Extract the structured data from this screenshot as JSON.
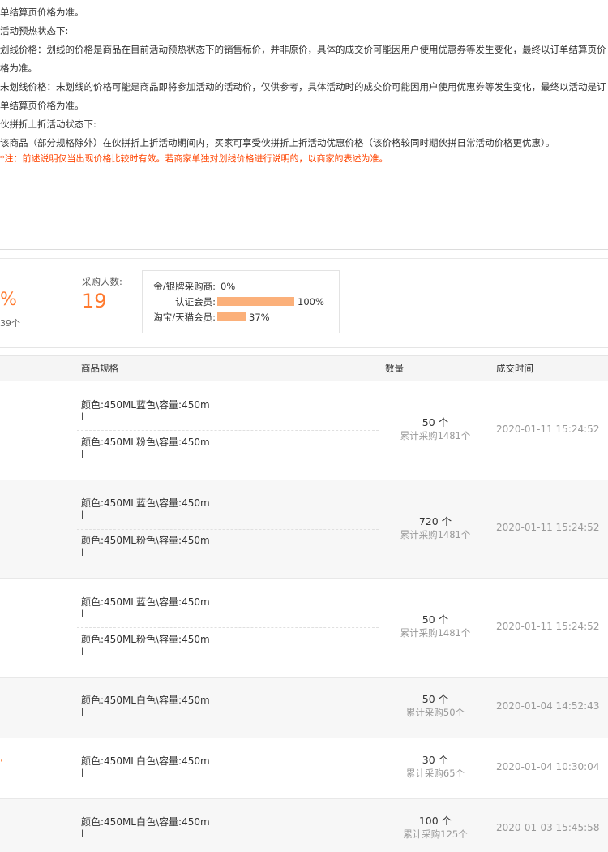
{
  "notice": {
    "lines": [
      "单结算页价格为准。",
      "活动预热状态下:",
      "划线价格：划线的价格是商品在目前活动预热状态下的销售标价，并非原价，具体的成交价可能因用户使用优惠券等发生变化，最终以订单结算页价",
      "格为准。",
      "未划线价格：未划线的价格可能是商品即将参加活动的活动价，仅供参考，具体活动时的成交价可能因用户使用优惠券等发生变化，最终以活动是订",
      "单结算页价格为准。",
      "伙拼折上折活动状态下:",
      "该商品（部分规格除外）在伙拼折上折活动期间内，买家可享受伙拼折上折活动优惠价格（该价格较同时期伙拼日常活动价格更优惠）。"
    ],
    "warning": "*注：前述说明仅当出现价格比较时有效。若商家单独对划线价格进行说明的，以商家的表述为准。"
  },
  "stats": {
    "partial_percent": "%",
    "partial_count": "39个",
    "buyers_label": "采购人数:",
    "buyers_count": "19",
    "distribution": [
      {
        "label": "金/银牌采购商:",
        "percent": "0%",
        "value": 0
      },
      {
        "label": "认证会员:",
        "percent": "100%",
        "value": 100
      },
      {
        "label": "淘宝/天猫会员:",
        "percent": "37%",
        "value": 37
      }
    ],
    "bar_color": "#fbb07a"
  },
  "table": {
    "headers": {
      "spec": "商品规格",
      "qty": "数量",
      "time": "成交时间"
    },
    "rows": [
      {
        "specs": [
          "颜色:450ML蓝色\\容量:450ml",
          "颜色:450ML粉色\\容量:450ml"
        ],
        "qty": "50 个",
        "total": "累计采购1481个",
        "time": "2020-01-11 15:24:52"
      },
      {
        "specs": [
          "颜色:450ML蓝色\\容量:450ml",
          "颜色:450ML粉色\\容量:450ml"
        ],
        "qty": "720 个",
        "total": "累计采购1481个",
        "time": "2020-01-11 15:24:52"
      },
      {
        "specs": [
          "颜色:450ML蓝色\\容量:450ml",
          "颜色:450ML粉色\\容量:450ml"
        ],
        "qty": "50 个",
        "total": "累计采购1481个",
        "time": "2020-01-11 15:24:52"
      },
      {
        "specs": [
          "颜色:450ML白色\\容量:450ml"
        ],
        "qty": "50 个",
        "total": "累计采购50个",
        "time": "2020-01-04 14:52:43"
      },
      {
        "specs": [
          "颜色:450ML白色\\容量:450ml"
        ],
        "qty": "30 个",
        "total": "累计采购65个",
        "time": "2020-01-04 10:30:04"
      },
      {
        "specs": [
          "颜色:450ML白色\\容量:450ml"
        ],
        "qty": "100 个",
        "total": "累计采购125个",
        "time": "2020-01-03 15:45:58"
      }
    ]
  },
  "colors": {
    "accent": "#ff7a2f",
    "warning": "#ff4400",
    "alt_row": "#f7f7f7"
  }
}
